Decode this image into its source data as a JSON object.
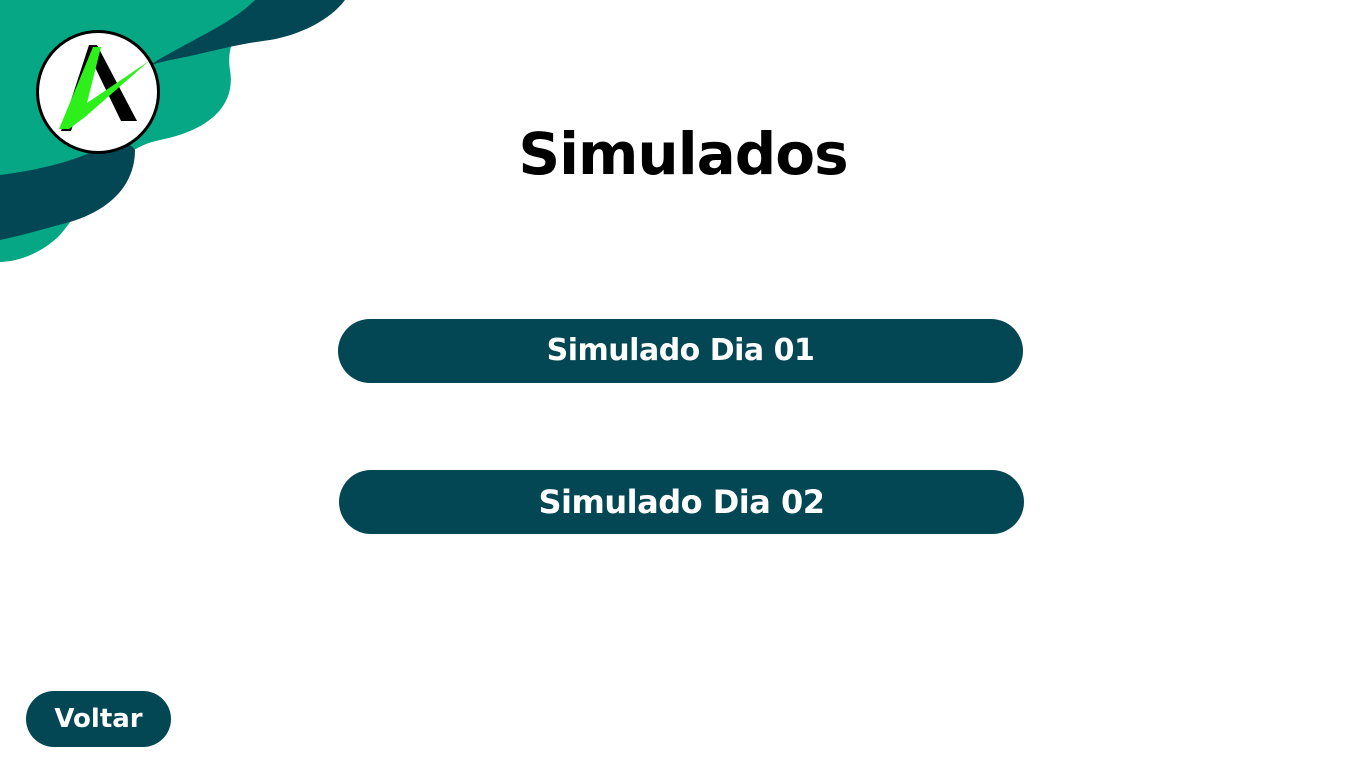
{
  "header": {
    "title": "Simulados",
    "logo_icon": "logo-a-checkmark-icon"
  },
  "options": [
    {
      "label": "Simulado Dia 01"
    },
    {
      "label": "Simulado Dia 02"
    }
  ],
  "footer": {
    "back_label": "Voltar"
  },
  "colors": {
    "primary": "#024753",
    "accent_green": "#06A784",
    "logo_green": "#2DF01A",
    "background": "#FFFFFF"
  }
}
